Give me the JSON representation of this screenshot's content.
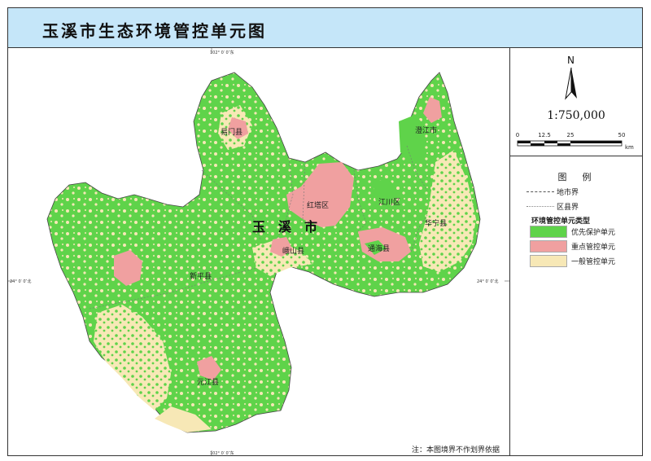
{
  "title": "玉溪市生态环境管控单元图",
  "coordinates": {
    "lon_top": "102° 0′ 0″东",
    "lon_bottom": "102° 0′ 0″东",
    "lat_left": "24° 0′ 0″北",
    "lat_right": "24° 0′ 0″北"
  },
  "map": {
    "city_name": "玉　溪　市",
    "districts": [
      "易门县",
      "澄江市",
      "红塔区",
      "江川区",
      "华宁县",
      "峨山县",
      "通海县",
      "新平县",
      "元江县"
    ]
  },
  "north_arrow": {
    "label": "N",
    "icon": "north-arrow-icon"
  },
  "scale": {
    "ratio": "1:750,000",
    "ticks": [
      "0",
      "12.5",
      "25",
      "50"
    ],
    "unit": "km"
  },
  "legend": {
    "title": "图　例",
    "boundary_items": [
      {
        "label": "地市界"
      },
      {
        "label": "区县界"
      }
    ],
    "section_title": "环境管控单元类型",
    "unit_types": [
      {
        "label": "优先保护单元",
        "color": "#5fd34a"
      },
      {
        "label": "重点管控单元",
        "color": "#f0a0a0"
      },
      {
        "label": "一般管控单元",
        "color": "#f7e8b6"
      }
    ]
  },
  "note": "注：本图境界不作划界依据"
}
